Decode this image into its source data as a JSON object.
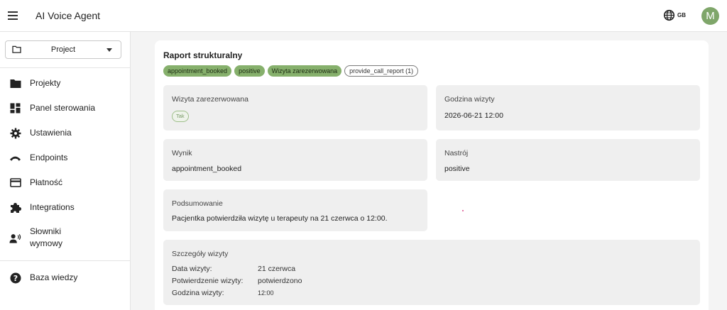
{
  "app": {
    "title": "AI Voice Agent"
  },
  "header": {
    "lang_code": "GB",
    "avatar_initial": "M"
  },
  "sidebar": {
    "project_select": "Project",
    "items": [
      {
        "label": "Projekty",
        "icon": "folder-icon"
      },
      {
        "label": "Panel sterowania",
        "icon": "dashboard-icon"
      },
      {
        "label": "Ustawienia",
        "icon": "gear-icon"
      },
      {
        "label": "Endpoints",
        "icon": "phone-icon"
      },
      {
        "label": "Płatność",
        "icon": "credit-card-icon"
      },
      {
        "label": "Integrations",
        "icon": "puzzle-icon"
      },
      {
        "label": "Słowniki wymowy",
        "icon": "voice-icon"
      },
      {
        "label": "Baza wiedzy",
        "icon": "help-icon"
      }
    ]
  },
  "report": {
    "title": "Raport strukturalny",
    "chips": [
      "appointment_booked",
      "positive",
      "Wizyta zarezerwowana"
    ],
    "action_chip": "provide_call_report (1)",
    "fields": {
      "booked": {
        "label": "Wizyta zarezerwowana",
        "value": "Tak"
      },
      "time": {
        "label": "Godzina wizyty",
        "value": "2026-06-21 12:00"
      },
      "result": {
        "label": "Wynik",
        "value": "appointment_booked"
      },
      "mood": {
        "label": "Nastrój",
        "value": "positive"
      },
      "summary": {
        "label": "Podsumowanie",
        "value": "Pacjentka potwierdziła wizytę u terapeuty na 21 czerwca o 12:00."
      }
    },
    "details": {
      "label": "Szczegóły wizyty",
      "rows": [
        {
          "key": "Data wizyty:",
          "value": "21 czerwca"
        },
        {
          "key": "Potwierdzenie wizyty:",
          "value": "potwierdzono"
        },
        {
          "key": "Godzina wizyty:",
          "value": "12:00"
        }
      ]
    }
  }
}
